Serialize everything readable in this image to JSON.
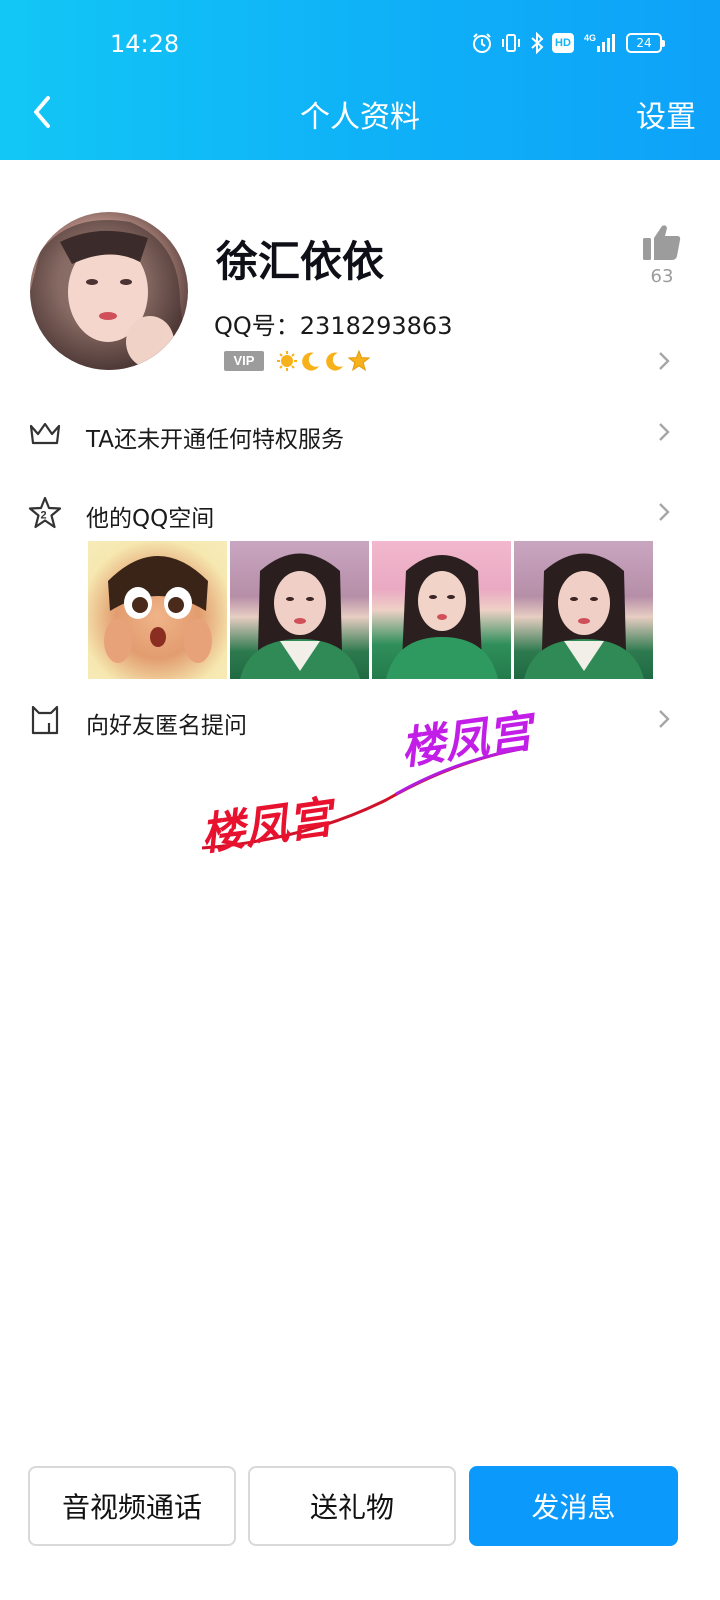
{
  "status_bar": {
    "time": "14:28",
    "hd_label": "HD",
    "network_label": "4G",
    "battery_level": "24"
  },
  "header": {
    "title": "个人资料",
    "settings_label": "设置"
  },
  "profile": {
    "nickname": "徐汇依依",
    "qq_number": "QQ号：2318293863",
    "vip_label": "VIP",
    "like_count": "63"
  },
  "rows": {
    "privilege_label": "TA还未开通任何特权服务",
    "qzone_label": "他的QQ空间",
    "qzone_badge": "2",
    "anon_question_label": "向好友匿名提问"
  },
  "watermark": {
    "text_left": "楼凤宫",
    "text_right": "楼凤宫"
  },
  "bottom_bar": {
    "call_label": "音视频通话",
    "gift_label": "送礼物",
    "message_label": "发消息"
  },
  "colors": {
    "header_gradient_start": "#12c7f6",
    "header_gradient_end": "#0ea2f9",
    "primary_button": "#0b99fb",
    "watermark_red": "#e8122f",
    "watermark_purple": "#c21ee8"
  }
}
